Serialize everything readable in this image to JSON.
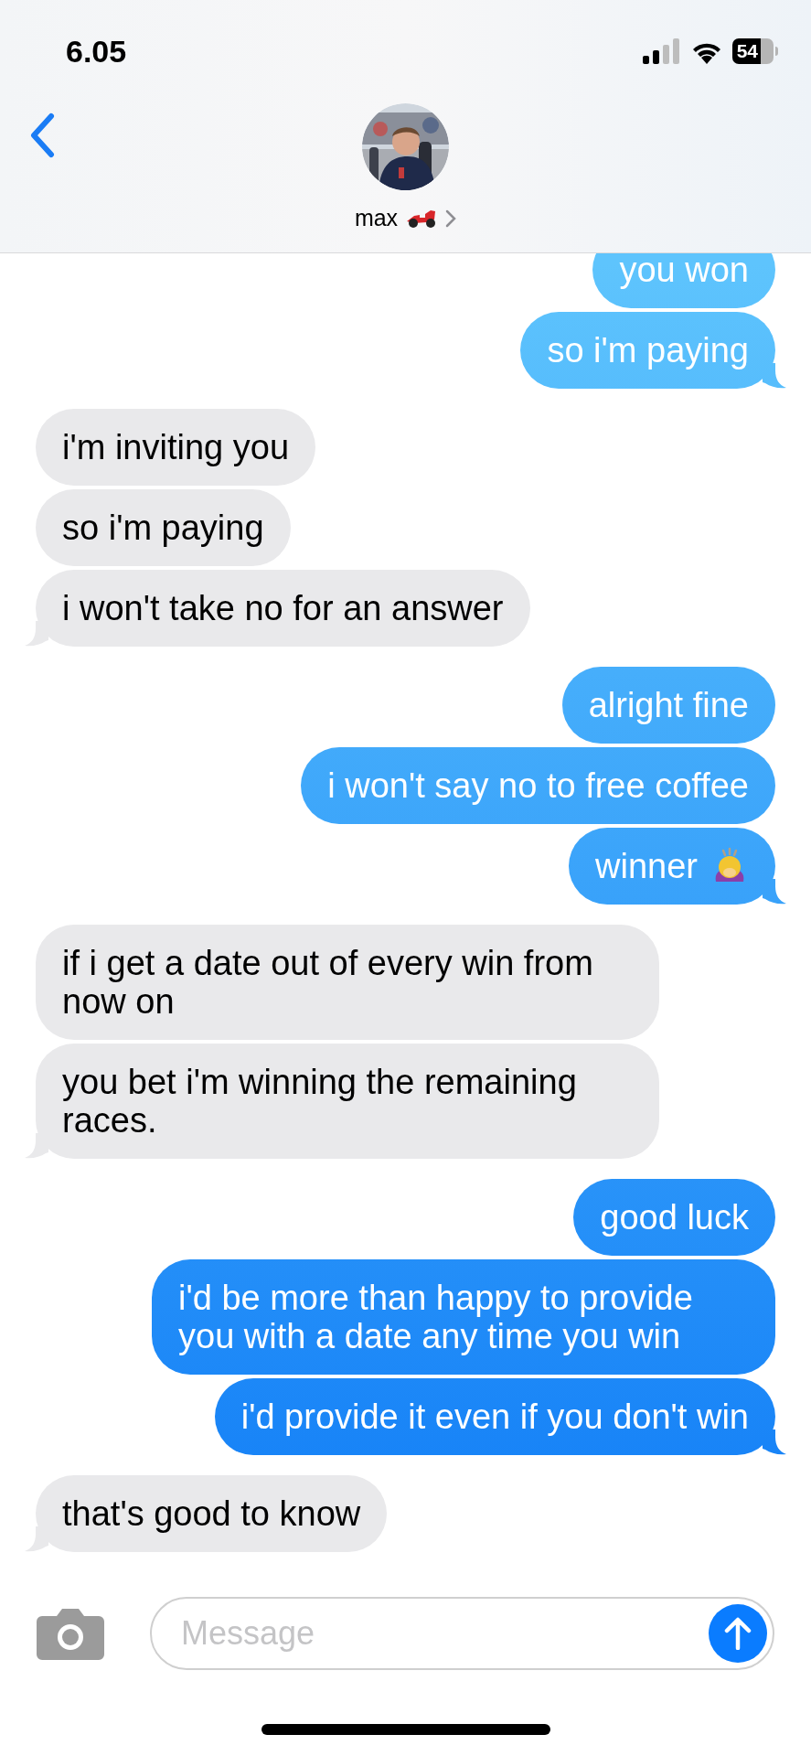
{
  "status_bar": {
    "time": "6.05",
    "battery": "54"
  },
  "header": {
    "contact_name": "max"
  },
  "messages": [
    {
      "kind": "sent",
      "text": "you won",
      "tail": false
    },
    {
      "kind": "sent",
      "text": "so i'm paying",
      "tail": true
    },
    {
      "kind": "received",
      "text": "i'm inviting you",
      "tail": false
    },
    {
      "kind": "received",
      "text": "so i'm paying",
      "tail": false
    },
    {
      "kind": "received",
      "text": "i won't take no for an answer",
      "tail": true
    },
    {
      "kind": "sent",
      "text": "alright fine",
      "tail": false
    },
    {
      "kind": "sent",
      "text": "i won't say no to free coffee",
      "tail": false
    },
    {
      "kind": "sent_emoji",
      "text": "winner",
      "tail": true
    },
    {
      "kind": "received",
      "text": "if i get a date out of every win from now on",
      "tail": false
    },
    {
      "kind": "received",
      "text": "you bet i'm winning the remaining races.",
      "tail": true
    },
    {
      "kind": "sent",
      "text": "good luck",
      "tail": false
    },
    {
      "kind": "sent",
      "text": "i'd be more than happy to provide you with a date any time you win",
      "tail": false
    },
    {
      "kind": "sent",
      "text": "i'd provide it even if you don't win",
      "tail": true
    },
    {
      "kind": "received",
      "text": "that's good to know",
      "tail": true
    }
  ],
  "composer": {
    "placeholder": "Message"
  }
}
